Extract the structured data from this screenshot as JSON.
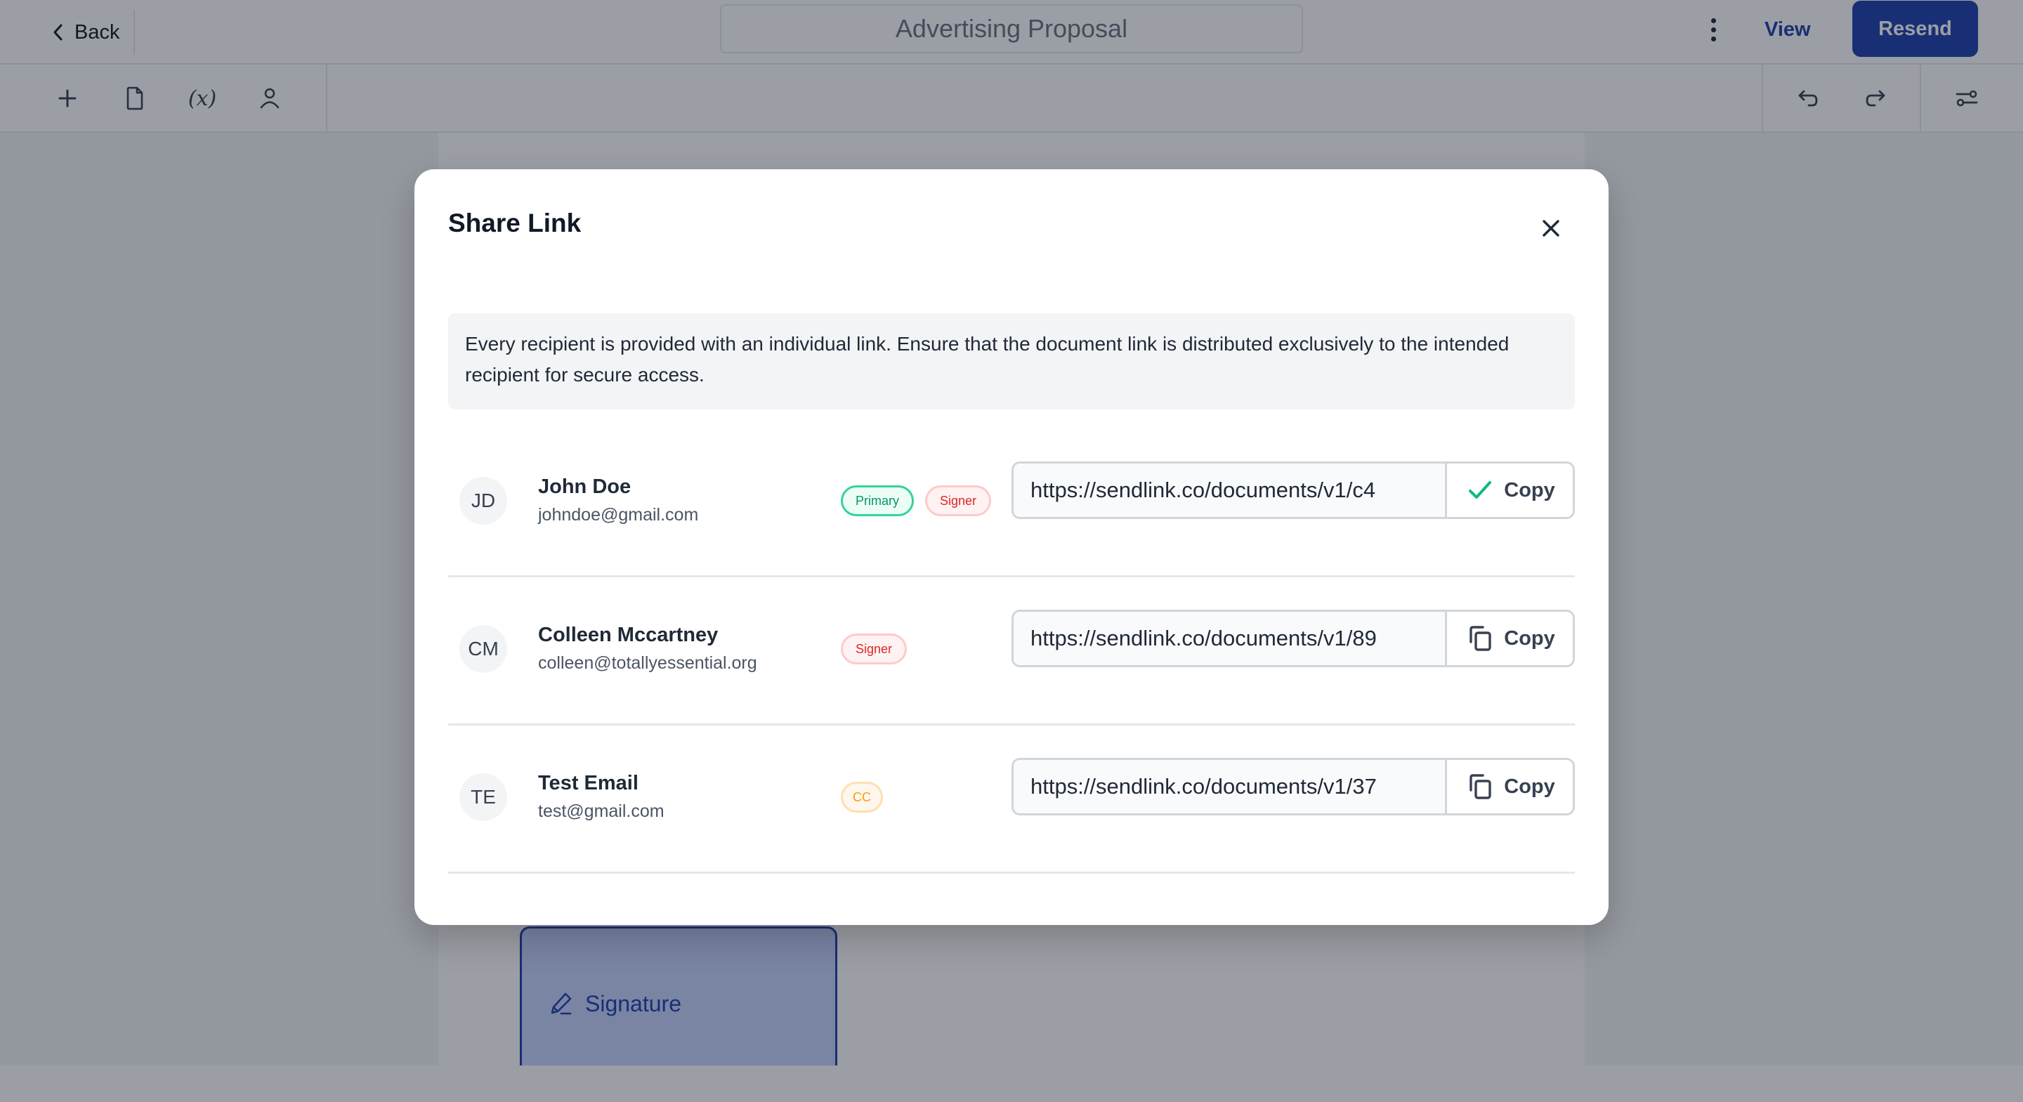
{
  "header": {
    "back_label": "Back",
    "document_title": "Advertising Proposal",
    "more_icon": "kebab-vertical-icon",
    "view_label": "View",
    "resend_label": "Resend"
  },
  "toolbar": {
    "left_tools": [
      {
        "name": "add",
        "icon": "plus-icon"
      },
      {
        "name": "document",
        "icon": "document-icon"
      },
      {
        "name": "variables",
        "icon": "variable-icon",
        "glyph": "(x)"
      },
      {
        "name": "recipients",
        "icon": "user-icon"
      }
    ],
    "right_tools": [
      {
        "name": "undo",
        "icon": "undo-icon"
      },
      {
        "name": "redo",
        "icon": "redo-icon"
      },
      {
        "name": "settings",
        "icon": "sliders-icon"
      }
    ]
  },
  "canvas": {
    "signature_field_label": "Signature"
  },
  "modal": {
    "title": "Share Link",
    "close_icon": "close-icon",
    "notice": "Every recipient is provided with an individual link. Ensure that the document link is distributed exclusively to the intended recipient for secure access.",
    "recipients": [
      {
        "initials": "JD",
        "name": "John Doe",
        "email": "johndoe@gmail.com",
        "badges": [
          {
            "label": "Primary",
            "type": "primary"
          },
          {
            "label": "Signer",
            "type": "signer"
          }
        ],
        "link": "https://sendlink.co/documents/v1/c4",
        "copy_label": "Copy",
        "copy_state": "copied",
        "copy_icon": "check-icon"
      },
      {
        "initials": "CM",
        "name": "Colleen Mccartney",
        "email": "colleen@totallyessential.org",
        "badges": [
          {
            "label": "Signer",
            "type": "signer"
          }
        ],
        "link": "https://sendlink.co/documents/v1/89",
        "copy_label": "Copy",
        "copy_state": "idle",
        "copy_icon": "copy-icon"
      },
      {
        "initials": "TE",
        "name": "Test Email",
        "email": "test@gmail.com",
        "badges": [
          {
            "label": "CC",
            "type": "cc"
          }
        ],
        "link": "https://sendlink.co/documents/v1/37",
        "copy_label": "Copy",
        "copy_state": "idle",
        "copy_icon": "copy-icon"
      }
    ]
  },
  "colors": {
    "brand": "#1e40af",
    "success": "#10b981",
    "signer": "#dc2626",
    "cc": "#f59e0b"
  }
}
